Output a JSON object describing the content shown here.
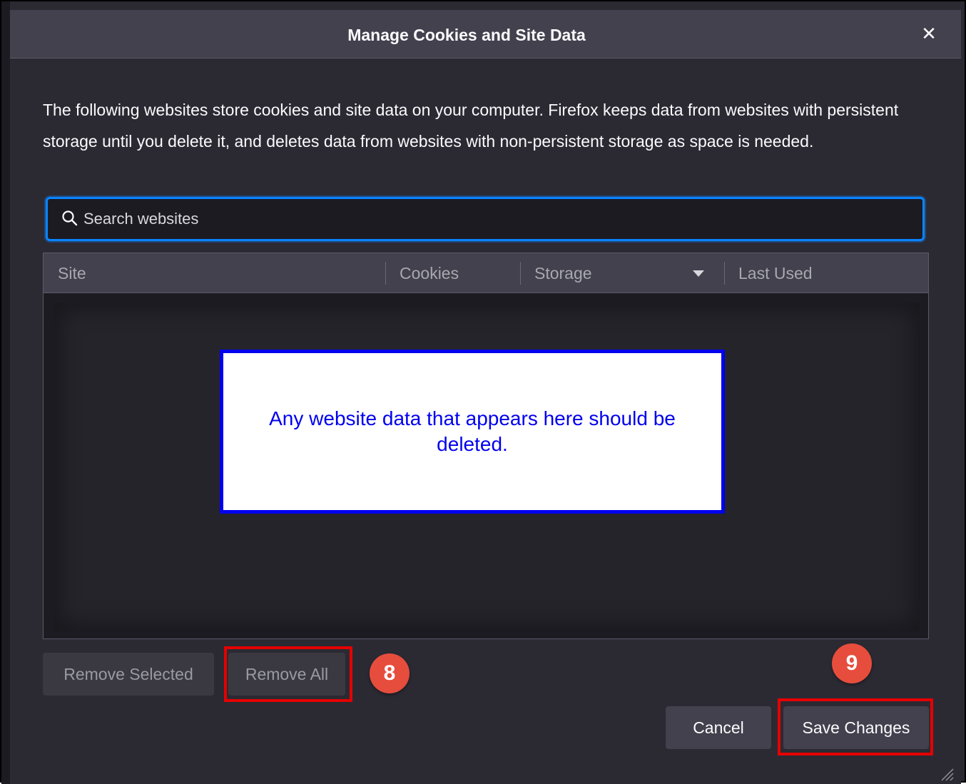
{
  "dialog": {
    "title": "Manage Cookies and Site Data",
    "close_glyph": "✕",
    "description": "The following websites store cookies and site data on your computer. Firefox keeps data from websites with persistent storage until you delete it, and deletes data from websites with non-persistent storage as space is needed."
  },
  "search": {
    "placeholder": "Search websites",
    "value": "",
    "icon": "search-icon"
  },
  "table": {
    "columns": [
      "Site",
      "Cookies",
      "Storage",
      "Last Used"
    ],
    "sorted_column": "Storage",
    "rows": []
  },
  "notice": {
    "text": "Any website data that appears here should be deleted."
  },
  "buttons": {
    "remove_selected": "Remove Selected",
    "remove_all": "Remove All",
    "cancel": "Cancel",
    "save_changes": "Save Changes"
  },
  "steps": {
    "remove_all_step": "8",
    "save_step": "9"
  },
  "colors": {
    "accent": "#0a84ff",
    "highlight": "#e60000",
    "badge": "#e64d3d",
    "notice_text": "#0000ee"
  }
}
